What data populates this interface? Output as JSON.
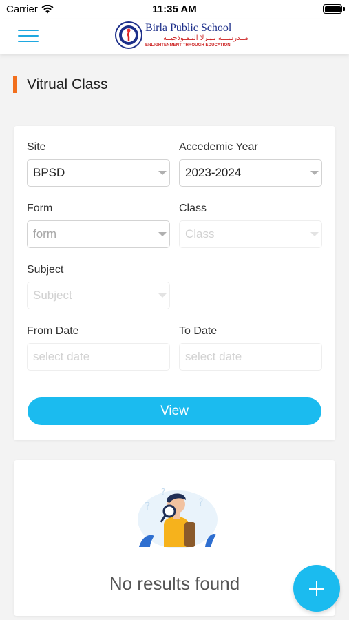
{
  "status_bar": {
    "carrier": "Carrier",
    "time": "11:35 AM"
  },
  "header": {
    "logo": {
      "title": "Birla Public School",
      "arabic": "مــدرســـة بـيـرلا النـمـوذجيــة",
      "tagline": "ENLIGHTENMENT THROUGH EDUCATION"
    }
  },
  "page": {
    "title": "Vitrual Class",
    "accent_color": "#f26f1d"
  },
  "filters": {
    "site": {
      "label": "Site",
      "value": "BPSD"
    },
    "academic_year": {
      "label": "Accedemic Year",
      "value": "2023-2024"
    },
    "form": {
      "label": "Form",
      "placeholder": "form"
    },
    "class": {
      "label": "Class",
      "placeholder": "Class"
    },
    "subject": {
      "label": "Subject",
      "placeholder": "Subject"
    },
    "from_date": {
      "label": "From Date",
      "placeholder": "select date"
    },
    "to_date": {
      "label": "To Date",
      "placeholder": "select date"
    },
    "view_button": "View"
  },
  "results": {
    "empty_message": "No results found"
  },
  "colors": {
    "primary": "#1bbbef",
    "menu": "#1fa8e0"
  },
  "icons": {
    "menu": "hamburger-menu-icon",
    "fab": "plus-icon",
    "dropdown": "chevron-down-icon"
  }
}
